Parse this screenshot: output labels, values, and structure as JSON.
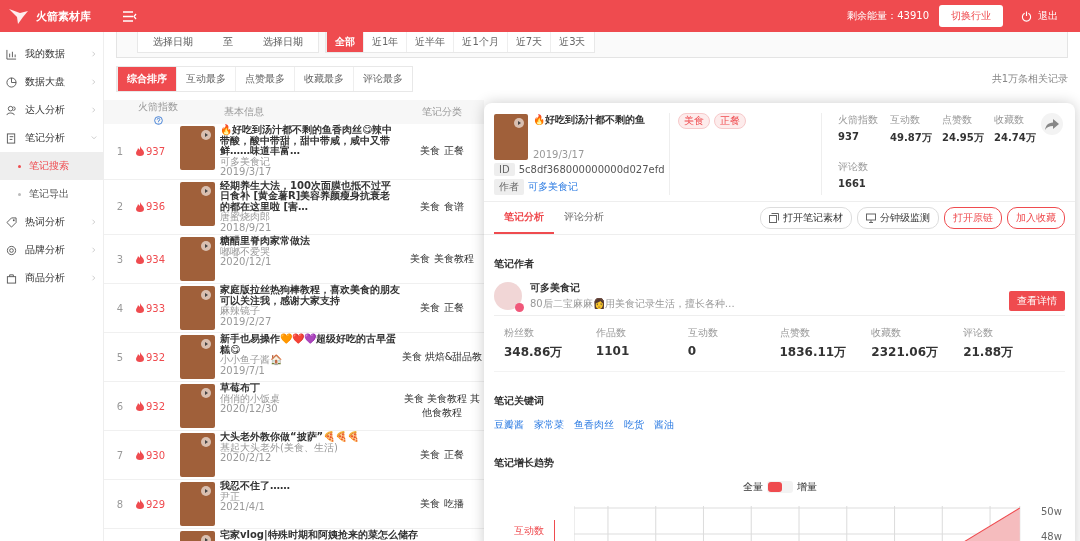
{
  "header": {
    "brand": "火箭素材库",
    "energy": "剩余能量：43910",
    "switch_button": "切换行业",
    "logout": "退出"
  },
  "sidebar": {
    "items": [
      {
        "label": "我的数据",
        "expanded": false
      },
      {
        "label": "数据大盘",
        "expanded": false
      },
      {
        "label": "达人分析",
        "expanded": false
      },
      {
        "label": "笔记分析",
        "expanded": true,
        "children": [
          {
            "label": "笔记搜索",
            "selected": true
          },
          {
            "label": "笔记导出",
            "selected": false
          }
        ]
      },
      {
        "label": "热词分析",
        "expanded": false
      },
      {
        "label": "品牌分析",
        "expanded": false
      },
      {
        "label": "商品分析",
        "expanded": false
      }
    ]
  },
  "date_filter": {
    "start_placeholder": "选择日期",
    "separator": "至",
    "end_placeholder": "选择日期",
    "ranges": [
      {
        "label": "全部",
        "selected": true
      },
      {
        "label": "近1年",
        "selected": false
      },
      {
        "label": "近半年",
        "selected": false
      },
      {
        "label": "近1个月",
        "selected": false
      },
      {
        "label": "近7天",
        "selected": false
      },
      {
        "label": "近3天",
        "selected": false
      }
    ]
  },
  "sort_tabs": [
    {
      "label": "综合排序",
      "selected": true
    },
    {
      "label": "互动最多",
      "selected": false
    },
    {
      "label": "点赞最多",
      "selected": false
    },
    {
      "label": "收藏最多",
      "selected": false
    },
    {
      "label": "评论最多",
      "selected": false
    }
  ],
  "total": "共1万条相关记录",
  "table": {
    "columns": [
      "火箭指数",
      "基本信息",
      "笔记分类"
    ],
    "rows": [
      {
        "rank": "1",
        "score": "937",
        "title": "🔥好吃到汤汁都不剩的鱼香肉丝😋辣中带酸，酸中带甜，甜中带咸，咸中又带鲜……味道丰富…",
        "author": "可多美食记",
        "date": "2019/3/17",
        "category": "美食 正餐"
      },
      {
        "rank": "2",
        "score": "936",
        "title": "经期养生大法，100次面膜也抵不过平日食补 [黄金薯R]美容养颜瘦身抗衰老的都在这里啦 [害…",
        "author": "唐蜜烧肉郎",
        "date": "2018/9/21",
        "category": "美食 食谱"
      },
      {
        "rank": "3",
        "score": "934",
        "title": "糖醋里脊肉家常做法",
        "author": "嘟嘟不爱哭",
        "date": "2020/12/1",
        "category": "美食 美食教程"
      },
      {
        "rank": "4",
        "score": "933",
        "title": "家庭版拉丝热狗棒教程，喜欢美食的朋友可以关注我，感谢大家支持",
        "author": "麻辣镜子",
        "date": "2019/2/27",
        "category": "美食 正餐"
      },
      {
        "rank": "5",
        "score": "932",
        "title": "新手也易操作🧡❤️💜超级好吃的古早蛋糕😋",
        "author": "小小鱼子酱🏠",
        "date": "2019/7/1",
        "category": "美食 烘焙&甜品教"
      },
      {
        "rank": "6",
        "score": "932",
        "title": "草莓布丁",
        "author": "俏俏的小饭桌",
        "date": "2020/12/30",
        "category": "美食 美食教程 其他食教程"
      },
      {
        "rank": "7",
        "score": "930",
        "title": "大头老外教你做“披萨”🍕🍕🍕",
        "author": "基起大头老外(美食、生活)",
        "date": "2020/2/12",
        "category": "美食 正餐"
      },
      {
        "rank": "8",
        "score": "929",
        "title": "我忍不住了……",
        "author": "尹正",
        "date": "2021/4/1",
        "category": "美食 吃播"
      },
      {
        "title": "宅家vlog|特殊时期和阿姨抢来的菜怎么储存"
      }
    ]
  },
  "detail": {
    "title": "🔥好吃到汤汁都不剩的鱼",
    "date": "2019/3/17",
    "id_label": "ID",
    "id": "5c8df368000000000d027efd",
    "author_label": "作者",
    "author": "可多美食记",
    "tags": [
      "美食",
      "正餐"
    ],
    "stats": [
      {
        "label": "火箭指数",
        "value": "937"
      },
      {
        "label": "互动数",
        "value": "49.87万"
      },
      {
        "label": "点赞数",
        "value": "24.95万"
      },
      {
        "label": "收藏数",
        "value": "24.74万"
      },
      {
        "label": "评论数",
        "value": "1661"
      }
    ],
    "tabs": [
      {
        "label": "笔记分析",
        "selected": true
      },
      {
        "label": "评论分析",
        "selected": false
      }
    ],
    "actions": [
      {
        "label": "打开笔记素材",
        "kind": "icon"
      },
      {
        "label": "分钟级监测",
        "kind": "monitor"
      },
      {
        "label": "打开原链",
        "kind": "outline"
      },
      {
        "label": "加入收藏",
        "kind": "outline"
      }
    ],
    "author_section": {
      "heading": "笔记作者",
      "name": "可多美食记",
      "bio": "80后二宝麻麻👩用美食记录生活，擅长各种…",
      "button": "查看详情",
      "stats": [
        {
          "label": "粉丝数",
          "value": "348.86万"
        },
        {
          "label": "作品数",
          "value": "1101"
        },
        {
          "label": "互动数",
          "value": "0"
        },
        {
          "label": "点赞数",
          "value": "1836.11万"
        },
        {
          "label": "收藏数",
          "value": "2321.06万"
        },
        {
          "label": "评论数",
          "value": "21.88万"
        }
      ]
    },
    "keywords": {
      "heading": "笔记关键词",
      "items": [
        "豆瓣酱",
        "家常菜",
        "鱼香肉丝",
        "吃货",
        "酱油"
      ]
    },
    "trend": {
      "heading": "笔记增长趋势",
      "left_label": "全量",
      "right_label": "增量",
      "on": false,
      "metric": "互动数",
      "ticks": [
        "50w",
        "48w"
      ]
    }
  }
}
